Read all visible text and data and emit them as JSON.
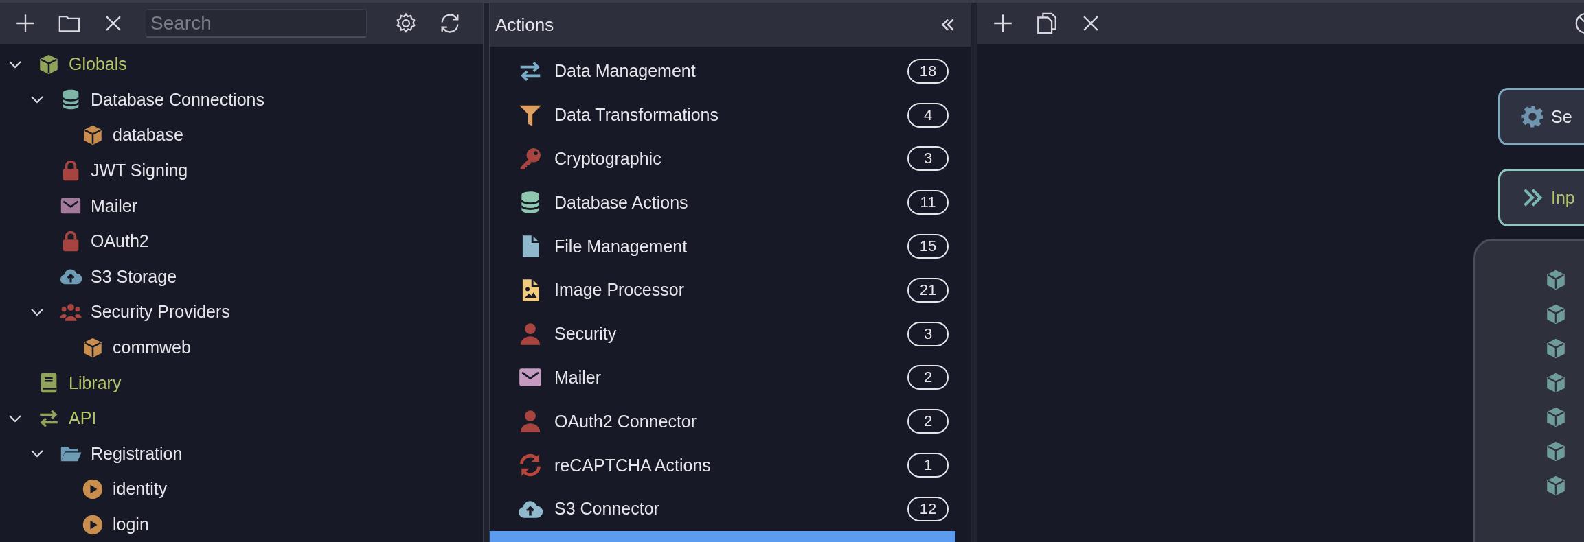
{
  "explorer": {
    "search": {
      "placeholder": "Search"
    },
    "tree": [
      {
        "label": "Globals",
        "kind": "cube",
        "color": "#8fa35a",
        "expanded": true,
        "children": [
          {
            "label": "Database Connections",
            "kind": "database",
            "color": "#7fb5a8",
            "expanded": true,
            "children": [
              {
                "label": "database",
                "kind": "cube",
                "color": "#c98d4e"
              }
            ]
          },
          {
            "label": "JWT Signing",
            "kind": "lock",
            "color": "#a8443f"
          },
          {
            "label": "Mailer",
            "kind": "mail",
            "color": "#a47a9c"
          },
          {
            "label": "OAuth2",
            "kind": "lock",
            "color": "#a8443f"
          },
          {
            "label": "S3 Storage",
            "kind": "cloud",
            "color": "#6f9cb5"
          },
          {
            "label": "Security Providers",
            "kind": "users",
            "color": "#a8443f",
            "expanded": true,
            "children": [
              {
                "label": "commweb",
                "kind": "cube",
                "color": "#c98d4e"
              }
            ]
          }
        ]
      },
      {
        "label": "Library",
        "kind": "book",
        "color": "#8fa35a"
      },
      {
        "label": "API",
        "kind": "swap",
        "color": "#8fa35a",
        "expanded": true,
        "children": [
          {
            "label": "Registration",
            "kind": "folder",
            "color": "#6f9cb5",
            "expanded": true,
            "children": [
              {
                "label": "identity",
                "kind": "play",
                "color": "#c98d4e"
              },
              {
                "label": "login",
                "kind": "play",
                "color": "#c98d4e"
              }
            ]
          }
        ]
      }
    ]
  },
  "actions": {
    "title": "Actions",
    "items": [
      {
        "label": "Data Management",
        "kind": "swap",
        "color": "#7aaec8",
        "count": "18",
        "selected": false
      },
      {
        "label": "Data Transformations",
        "kind": "funnel",
        "color": "#e0a060",
        "count": "4",
        "selected": false
      },
      {
        "label": "Cryptographic",
        "kind": "key",
        "color": "#a8443f",
        "count": "3",
        "selected": false
      },
      {
        "label": "Database Actions",
        "kind": "database",
        "color": "#8fc6b0",
        "count": "11",
        "selected": false
      },
      {
        "label": "File Management",
        "kind": "file",
        "color": "#8fb8cc",
        "count": "15",
        "selected": false
      },
      {
        "label": "Image Processor",
        "kind": "image",
        "color": "#f0cc80",
        "count": "21",
        "selected": false
      },
      {
        "label": "Security",
        "kind": "user",
        "color": "#a8443f",
        "count": "3",
        "selected": false
      },
      {
        "label": "Mailer",
        "kind": "mail",
        "color": "#c49ac0",
        "count": "2",
        "selected": false
      },
      {
        "label": "OAuth2 Connector",
        "kind": "user",
        "color": "#a8443f",
        "count": "2",
        "selected": false
      },
      {
        "label": "reCAPTCHA Actions",
        "kind": "refresh",
        "color": "#b8453c",
        "count": "1",
        "selected": false
      },
      {
        "label": "S3 Connector",
        "kind": "cloud",
        "color": "#8fb8cc",
        "count": "12",
        "selected": false
      },
      {
        "selected": true
      }
    ]
  },
  "canvas": {
    "nodes": [
      {
        "kind": "settings",
        "label": "Se"
      },
      {
        "kind": "input",
        "label": "Inp"
      }
    ]
  }
}
